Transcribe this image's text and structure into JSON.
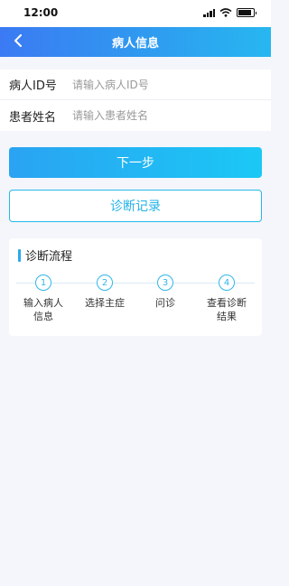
{
  "status_bar": {
    "time": "12:00",
    "battery_level": 0.85
  },
  "nav": {
    "title": "病人信息",
    "back_icon": "chevron-left-icon"
  },
  "form": {
    "patient_id": {
      "label": "病人ID号",
      "placeholder": "请输入病人ID号",
      "value": ""
    },
    "patient_name": {
      "label": "患者姓名",
      "placeholder": "请输入患者姓名",
      "value": ""
    }
  },
  "buttons": {
    "next": "下一步",
    "records": "诊断记录"
  },
  "flow": {
    "title": "诊断流程",
    "steps": [
      {
        "number": "1",
        "label": "输入病人信息"
      },
      {
        "number": "2",
        "label": "选择主症"
      },
      {
        "number": "3",
        "label": "问诊"
      },
      {
        "number": "4",
        "label": "查看诊断结果"
      }
    ]
  },
  "colors": {
    "nav_gradient_start": "#3b7af3",
    "nav_gradient_end": "#27b7f0",
    "accent": "#22b2e8",
    "background": "#f4f6fb"
  }
}
